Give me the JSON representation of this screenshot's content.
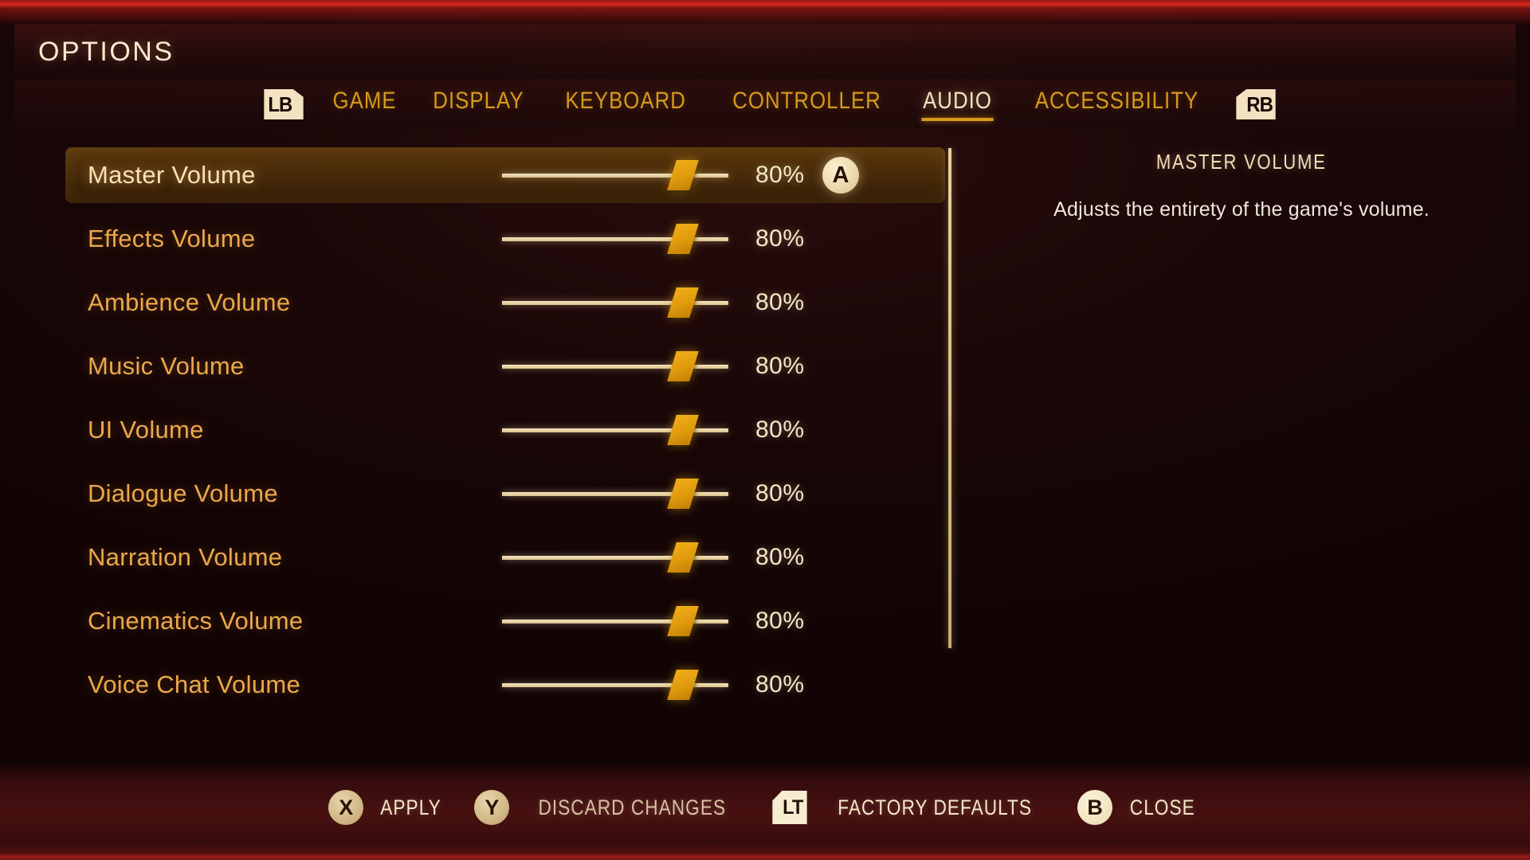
{
  "header": {
    "title": "OPTIONS"
  },
  "tabs": {
    "prev_bumper": "LB",
    "next_bumper": "RB",
    "items": [
      {
        "label": "GAME",
        "active": false
      },
      {
        "label": "DISPLAY",
        "active": false
      },
      {
        "label": "KEYBOARD",
        "active": false
      },
      {
        "label": "CONTROLLER",
        "active": false
      },
      {
        "label": "AUDIO",
        "active": true
      },
      {
        "label": "ACCESSIBILITY",
        "active": false
      }
    ]
  },
  "options": {
    "selected_index": 0,
    "confirm_glyph": "A",
    "rows": [
      {
        "label": "Master Volume",
        "value": "80%",
        "percent": 80,
        "selected": true
      },
      {
        "label": "Effects Volume",
        "value": "80%",
        "percent": 80,
        "selected": false
      },
      {
        "label": "Ambience Volume",
        "value": "80%",
        "percent": 80,
        "selected": false
      },
      {
        "label": "Music Volume",
        "value": "80%",
        "percent": 80,
        "selected": false
      },
      {
        "label": "UI Volume",
        "value": "80%",
        "percent": 80,
        "selected": false
      },
      {
        "label": "Dialogue Volume",
        "value": "80%",
        "percent": 80,
        "selected": false
      },
      {
        "label": "Narration Volume",
        "value": "80%",
        "percent": 80,
        "selected": false
      },
      {
        "label": "Cinematics Volume",
        "value": "80%",
        "percent": 80,
        "selected": false
      },
      {
        "label": "Voice Chat Volume",
        "value": "80%",
        "percent": 80,
        "selected": false
      }
    ]
  },
  "description": {
    "title": "MASTER VOLUME",
    "text": "Adjusts the entirety of the game's volume."
  },
  "footer": {
    "actions": [
      {
        "glyph": "X",
        "glyph_kind": "circle",
        "label": "APPLY"
      },
      {
        "glyph": "Y",
        "glyph_kind": "circle",
        "label": "DISCARD CHANGES"
      },
      {
        "glyph": "LT",
        "glyph_kind": "trigger",
        "label": "FACTORY DEFAULTS"
      },
      {
        "glyph": "B",
        "glyph_kind": "circle-bright",
        "label": "CLOSE"
      }
    ]
  },
  "colors": {
    "accent_gold": "#d69a1c",
    "label_gold": "#eaa84a",
    "cream": "#f6e7c2",
    "slider_thumb": "#f0ae18",
    "top_strip_red": "#c4221b",
    "highlight_row": "#5c390c"
  }
}
